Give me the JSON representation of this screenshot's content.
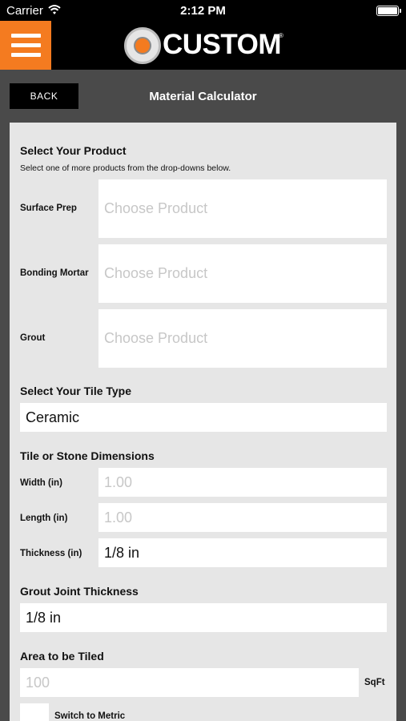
{
  "status_bar": {
    "carrier": "Carrier",
    "time": "2:12 PM"
  },
  "header": {
    "logo_text": "CUSTOM",
    "logo_mark": "®"
  },
  "nav": {
    "back_label": "BACK",
    "title": "Material Calculator"
  },
  "product": {
    "title": "Select Your Product",
    "subtitle": "Select one of more products from the drop-downs below.",
    "rows": [
      {
        "label": "Surface Prep",
        "placeholder": "Choose Product"
      },
      {
        "label": "Bonding Mortar",
        "placeholder": "Choose Product"
      },
      {
        "label": "Grout",
        "placeholder": "Choose Product"
      }
    ]
  },
  "tile_type": {
    "title": "Select Your Tile Type",
    "value": "Ceramic"
  },
  "dimensions": {
    "title": "Tile or Stone Dimensions",
    "width_label": "Width (in)",
    "width_placeholder": "1.00",
    "length_label": "Length (in)",
    "length_placeholder": "1.00",
    "thickness_label": "Thickness (in)",
    "thickness_value": "1/8 in"
  },
  "grout_joint": {
    "title": "Grout Joint Thickness",
    "value": "1/8 in"
  },
  "area": {
    "title": "Area to be Tiled",
    "placeholder": "100",
    "unit": "SqFt"
  },
  "metric": {
    "label": "Switch to Metric"
  },
  "colors": {
    "accent": "#f47b20",
    "header_bg": "#000000",
    "page_bg": "#4a4a4a",
    "panel_bg": "#e6e6e6"
  },
  "icons": {
    "menu": "hamburger-menu-icon",
    "wifi": "wifi-icon",
    "battery": "battery-icon"
  }
}
